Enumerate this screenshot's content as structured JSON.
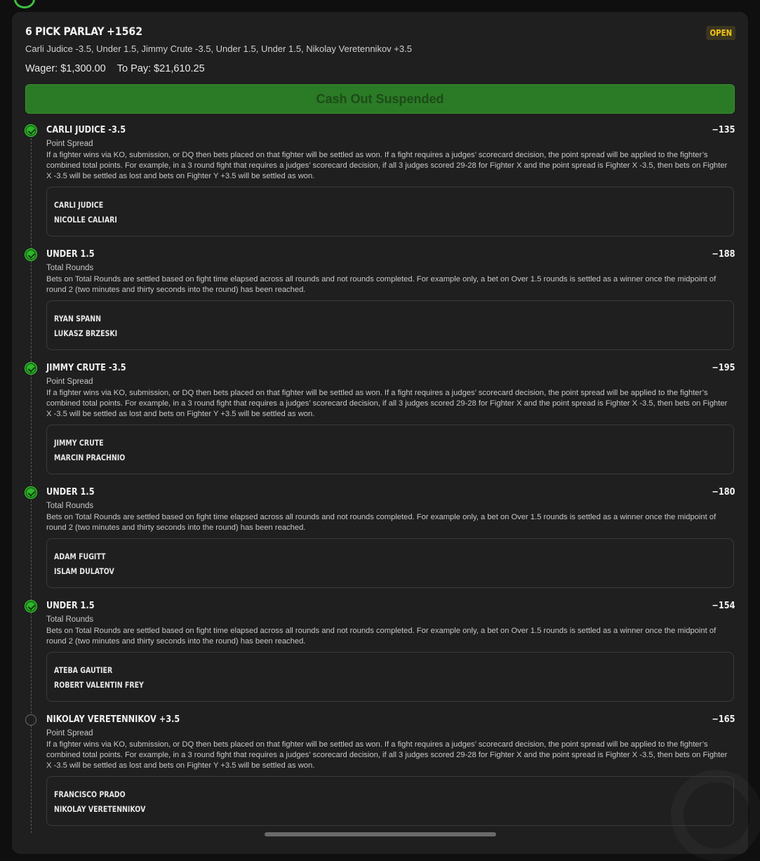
{
  "bet": {
    "title": "6 PICK PARLAY",
    "odds": "+1562",
    "status": "OPEN",
    "summary": "Carli Judice -3.5, Under 1.5, Jimmy Crute -3.5, Under 1.5, Under 1.5, Nikolay Veretennikov +3.5",
    "wager": "Wager: $1,300.00",
    "to_pay": "To Pay: $21,610.25",
    "cashout_label": "Cash Out Suspended"
  },
  "legs": [
    {
      "state": "won",
      "title": "CARLI JUDICE -3.5",
      "odds": "−135",
      "market": "Point Spread",
      "description": "If a fighter wins via KO, submission, or DQ then bets placed on that fighter will be settled as won. If a fight requires a judges’ scorecard decision, the point spread will be applied to the fighter’s combined total points. For example, in a 3 round fight that requires a judges’ scorecard decision, if all 3 judges scored 29-28 for Fighter X and the point spread is Fighter X -3.5, then bets on Fighter X -3.5 will be settled as lost and bets on Fighter Y +3.5 will be settled as won.",
      "fighter1": "CARLI JUDICE",
      "fighter2": "NICOLLE CALIARI"
    },
    {
      "state": "won",
      "title": "UNDER 1.5",
      "odds": "−188",
      "market": "Total Rounds",
      "description": "Bets on Total Rounds are settled based on fight time elapsed across all rounds and not rounds completed. For example only, a bet on Over 1.5 rounds is settled as a winner once the midpoint of round 2 (two minutes and thirty seconds into the round) has been reached.",
      "fighter1": "RYAN SPANN",
      "fighter2": "LUKASZ BRZESKI"
    },
    {
      "state": "won",
      "title": "JIMMY CRUTE -3.5",
      "odds": "−195",
      "market": "Point Spread",
      "description": "If a fighter wins via KO, submission, or DQ then bets placed on that fighter will be settled as won. If a fight requires a judges’ scorecard decision, the point spread will be applied to the fighter’s combined total points. For example, in a 3 round fight that requires a judges’ scorecard decision, if all 3 judges scored 29-28 for Fighter X and the point spread is Fighter X -3.5, then bets on Fighter X -3.5 will be settled as lost and bets on Fighter Y +3.5 will be settled as won.",
      "fighter1": "JIMMY CRUTE",
      "fighter2": "MARCIN PRACHNIO"
    },
    {
      "state": "won",
      "title": "UNDER 1.5",
      "odds": "−180",
      "market": "Total Rounds",
      "description": "Bets on Total Rounds are settled based on fight time elapsed across all rounds and not rounds completed. For example only, a bet on Over 1.5 rounds is settled as a winner once the midpoint of round 2 (two minutes and thirty seconds into the round) has been reached.",
      "fighter1": "ADAM FUGITT",
      "fighter2": "ISLAM DULATOV"
    },
    {
      "state": "won",
      "title": "UNDER 1.5",
      "odds": "−154",
      "market": "Total Rounds",
      "description": "Bets on Total Rounds are settled based on fight time elapsed across all rounds and not rounds completed. For example only, a bet on Over 1.5 rounds is settled as a winner once the midpoint of round 2 (two minutes and thirty seconds into the round) has been reached.",
      "fighter1": "ATEBA GAUTIER",
      "fighter2": "ROBERT VALENTIN FREY"
    },
    {
      "state": "pending",
      "title": "NIKOLAY VERETENNIKOV +3.5",
      "odds": "−165",
      "market": "Point Spread",
      "description": "If a fighter wins via KO, submission, or DQ then bets placed on that fighter will be settled as won. If a fight requires a judges’ scorecard decision, the point spread will be applied to the fighter’s combined total points. For example, in a 3 round fight that requires a judges’ scorecard decision, if all 3 judges scored 29-28 for Fighter X and the point spread is Fighter X -3.5, then bets on Fighter X -3.5 will be settled as lost and bets on Fighter Y +3.5 will be settled as won.",
      "fighter1": "FRANCISCO PRADO",
      "fighter2": "NIKOLAY VERETENNIKOV"
    }
  ]
}
